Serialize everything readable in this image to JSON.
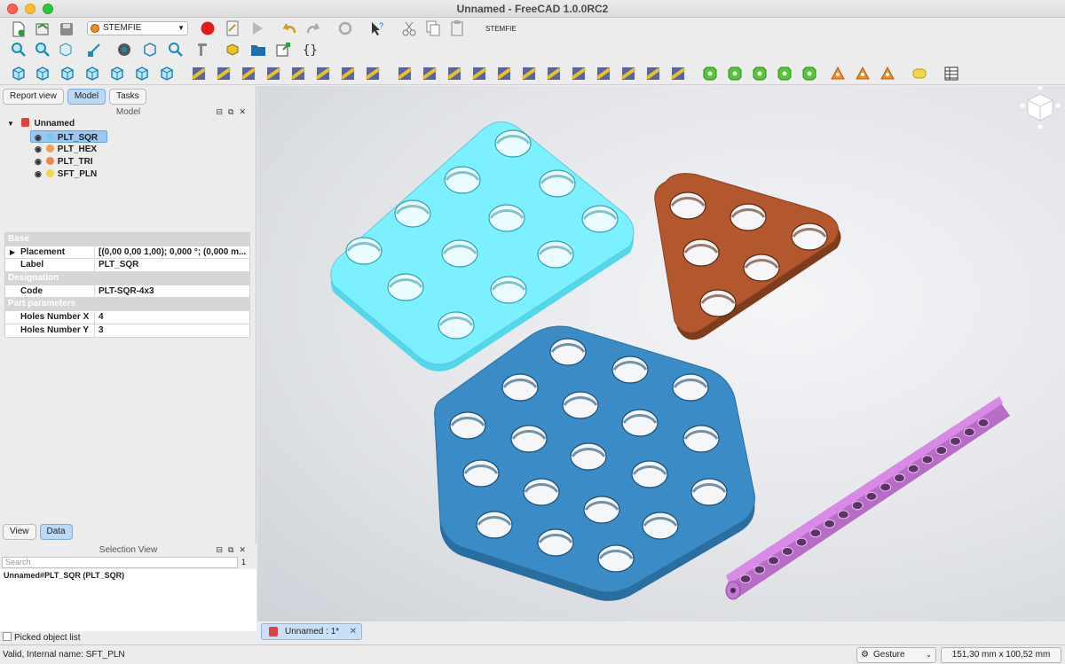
{
  "window": {
    "title": "Unnamed - FreeCAD 1.0.0RC2"
  },
  "toolbar": {
    "workbench_selector": "STEMFIE",
    "workbench_label": "STEMFIE"
  },
  "left_panel": {
    "tabs": [
      "Report view",
      "Model",
      "Tasks"
    ],
    "active_tab": "Model",
    "model_header": "Model",
    "tree": {
      "root": "Unnamed",
      "items": [
        {
          "label": "PLT_SQR",
          "color": "#7cc7ef"
        },
        {
          "label": "PLT_HEX",
          "color": "#f0a050"
        },
        {
          "label": "PLT_TRI",
          "color": "#e6884c"
        },
        {
          "label": "SFT_PLN",
          "color": "#f2d54a"
        }
      ]
    },
    "properties": {
      "group_base": "Base",
      "placement_key": "Placement",
      "placement_val": "[(0,00 0,00 1,00); 0,000 °; (0,000 m...",
      "label_key": "Label",
      "label_val": "PLT_SQR",
      "group_designation": "Designation",
      "code_key": "Code",
      "code_val": "PLT-SQR-4x3",
      "group_part": "Part parameters",
      "holes_x_key": "Holes Number X",
      "holes_x_val": "4",
      "holes_y_key": "Holes Number Y",
      "holes_y_val": "3"
    },
    "bottom_tabs": [
      "View",
      "Data"
    ],
    "active_bottom_tab": "Data"
  },
  "selection_view": {
    "header": "Selection View",
    "search_placeholder": "Search",
    "count": "1",
    "items": [
      "Unnamed#PLT_SQR (PLT_SQR)"
    ],
    "picked_label": "Picked object list"
  },
  "document_tab": {
    "label": "Unnamed : 1*"
  },
  "status_bar": {
    "message": "Valid, Internal name: SFT_PLN",
    "navigation": "Gesture",
    "dimensions": "151,30 mm x 100,52 mm"
  },
  "scene_colors": {
    "square_plate": "#7df0ff",
    "triangle_plate": "#b3582e",
    "hex_plate": "#3b8cc6",
    "shaft": "#d88ae6"
  }
}
